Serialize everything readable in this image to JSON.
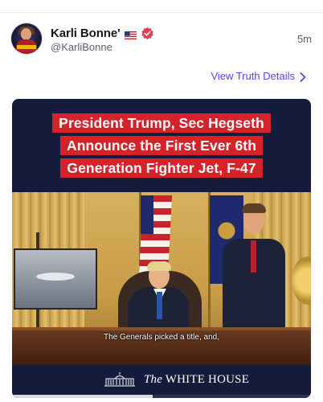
{
  "post": {
    "display_name": "Karli Bonne'",
    "handle": "@KarliBonne",
    "timestamp": "5m",
    "flag_icon": "us-flag-icon",
    "verified_icon": "verified-badge-icon",
    "verified_color": "#e83a52"
  },
  "actions": {
    "view_details_label": "View Truth Details",
    "view_details_color": "#5448ee",
    "chevron_icon": "chevron-right-icon"
  },
  "media": {
    "headline_lines": [
      "President Trump, Sec Hegseth",
      "Announce the First Ever 6th",
      "Generation Fighter Jet, F-47"
    ],
    "headline_bg": "#d6232a",
    "caption": "The Generals picked a title, and,",
    "footer_the": "The",
    "footer_house": "WHITE HOUSE",
    "progress": 0.47
  }
}
